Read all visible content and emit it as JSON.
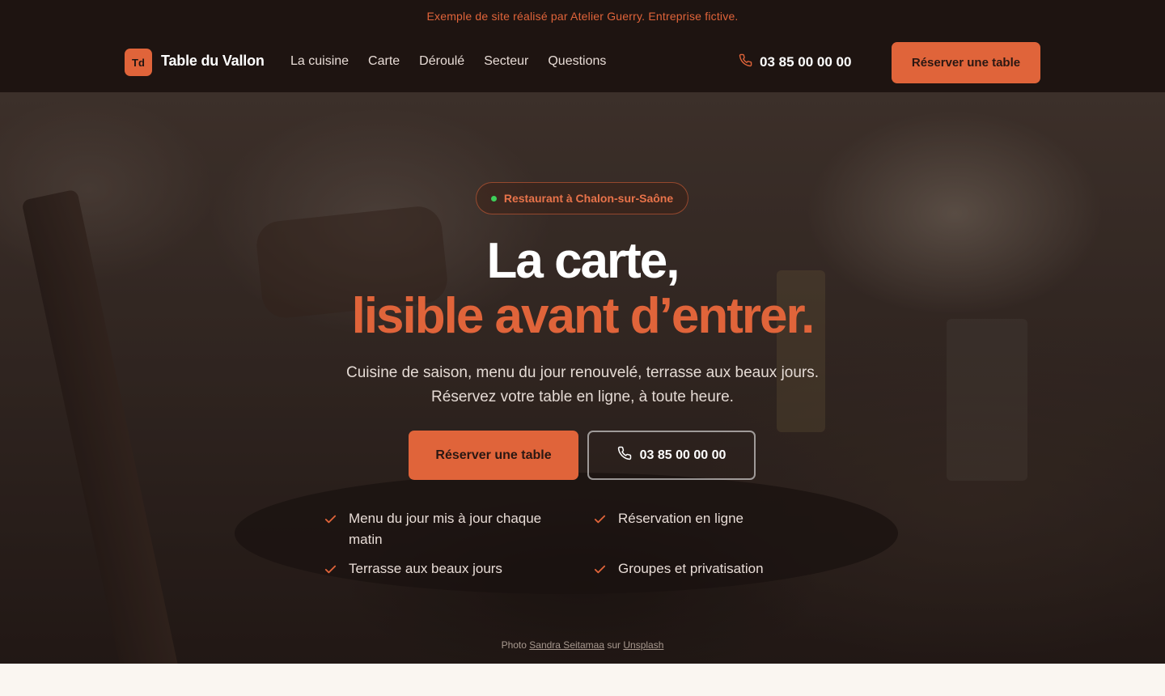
{
  "notice": {
    "text": "Exemple de site réalisé par Atelier Guerry. Entreprise fictive."
  },
  "header": {
    "logo_initials": "Td",
    "brand_name": "Table du Vallon",
    "nav": [
      {
        "label": "La cuisine"
      },
      {
        "label": "Carte"
      },
      {
        "label": "Déroulé"
      },
      {
        "label": "Secteur"
      },
      {
        "label": "Questions"
      }
    ],
    "phone": "03 85 00 00 00",
    "phone_icon": "phone-icon",
    "cta_label": "Réserver une table"
  },
  "hero": {
    "badge": "Restaurant à Chalon-sur-Saône",
    "title_line1": "La carte,",
    "title_line2": "lisible avant d’entrer.",
    "subtitle_line1": "Cuisine de saison, menu du jour renouvelé, terrasse aux beaux jours.",
    "subtitle_line2": "Réservez votre table en ligne, à toute heure.",
    "primary_cta": "Réserver une table",
    "secondary_cta": "03 85 00 00 00",
    "features": [
      {
        "text": "Menu du jour mis à jour chaque matin"
      },
      {
        "text": "Réservation en ligne"
      },
      {
        "text": "Terrasse aux beaux jours"
      },
      {
        "text": "Groupes et privatisation"
      }
    ],
    "credit": {
      "prefix": "Photo",
      "author": "Sandra Seitamaa",
      "middle": "sur",
      "source": "Unsplash"
    }
  },
  "colors": {
    "accent": "#e0643a",
    "dark_bg": "#1e1411",
    "status_dot": "#3ecf5a",
    "page_bg": "#faf6f1"
  }
}
